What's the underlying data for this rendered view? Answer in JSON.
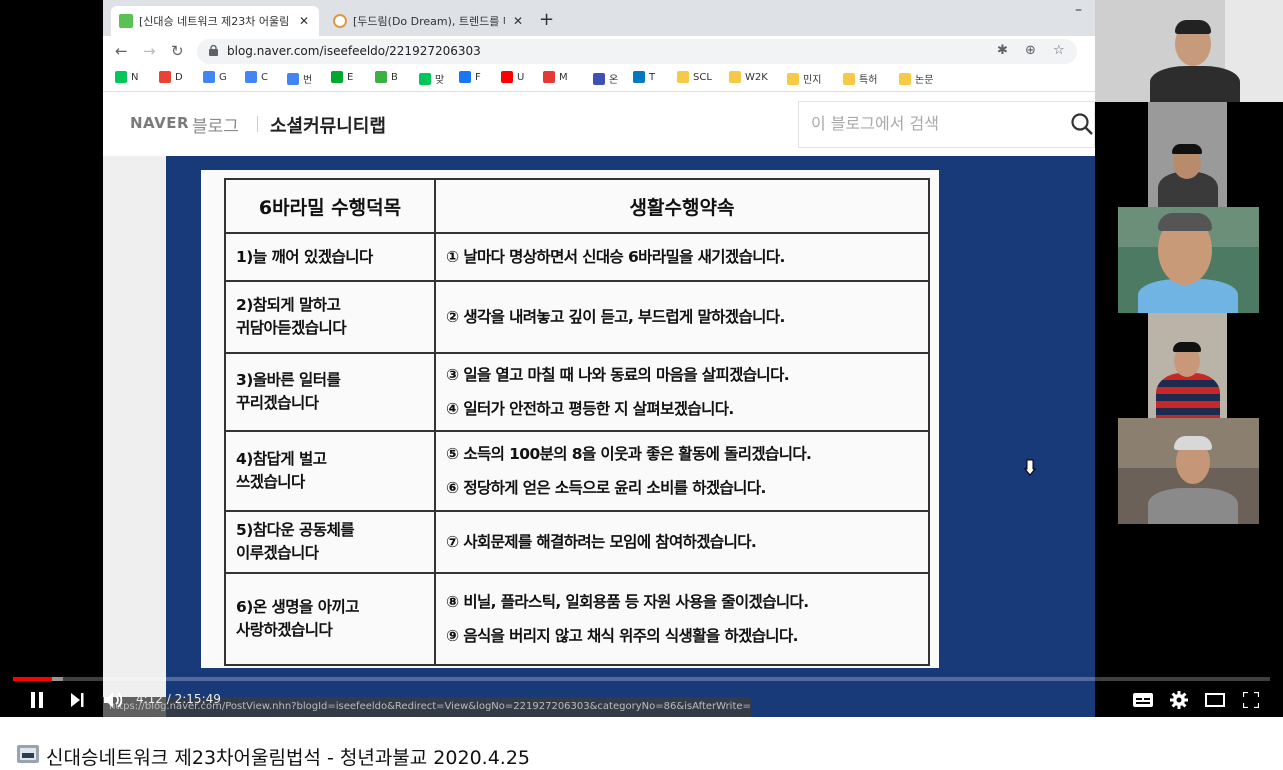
{
  "browser": {
    "tabs": [
      {
        "title": "[신대승 네트워크 제23차 어울림",
        "active": true
      },
      {
        "title": "[두드림(Do Dream), 트렌드를 다",
        "active": false
      }
    ],
    "new_tab": "+",
    "minimize": "–",
    "url": "blog.naver.com/iseefeeldo/221927206303",
    "bookmarks": [
      {
        "label": "N",
        "icon": "naver-icon",
        "color": "#03c75a"
      },
      {
        "label": "D",
        "icon": "mail-icon",
        "color": "#ea4335"
      },
      {
        "label": "G",
        "icon": "google-icon",
        "color": "#4285f4"
      },
      {
        "label": "C",
        "icon": "calendar-icon",
        "color": "#4285f4"
      },
      {
        "label": "번",
        "icon": "translate-icon",
        "color": "#4285f4"
      },
      {
        "label": "E",
        "icon": "evernote-icon",
        "color": "#00a82d"
      },
      {
        "label": "B",
        "icon": "blog-icon",
        "color": "#3bb143"
      },
      {
        "label": "맞",
        "icon": "naver-icon",
        "color": "#03c75a"
      },
      {
        "label": "F",
        "icon": "facebook-icon",
        "color": "#1877f2"
      },
      {
        "label": "U",
        "icon": "youtube-icon",
        "color": "#ff0000"
      },
      {
        "label": "M",
        "icon": "music-icon",
        "color": "#e53935"
      },
      {
        "label": "온",
        "icon": "target-icon",
        "color": "#3f51b5"
      },
      {
        "label": "T",
        "icon": "trello-icon",
        "color": "#0079bf"
      },
      {
        "label": "SCL",
        "icon": "folder-icon",
        "color": "#f7c948"
      },
      {
        "label": "W2K",
        "icon": "folder-icon",
        "color": "#f7c948"
      },
      {
        "label": "민지",
        "icon": "folder-icon",
        "color": "#f7c948"
      },
      {
        "label": "특허",
        "icon": "folder-icon",
        "color": "#f7c948"
      },
      {
        "label": "논문",
        "icon": "folder-icon",
        "color": "#f7c948"
      }
    ]
  },
  "naver": {
    "logo": "NAVER",
    "blog_word": "블로그",
    "blog_name": "소셜커뮤니티랩",
    "search_placeholder": "이 블로그에서 검색"
  },
  "slide": {
    "header_virtue": "6바라밀 수행덕목",
    "header_promise": "생활수행약속",
    "rows": [
      {
        "virtue": [
          "1)늘 깨어 있겠습니다"
        ],
        "promises": [
          "① 날마다 명상하면서 신대승 6바라밀을 새기겠습니다."
        ]
      },
      {
        "virtue": [
          "2)참되게 말하고",
          "귀담아듣겠습니다"
        ],
        "promises": [
          "② 생각을 내려놓고 깊이 듣고, 부드럽게 말하겠습니다."
        ]
      },
      {
        "virtue": [
          "3)올바른 일터를",
          "꾸리겠습니다"
        ],
        "promises": [
          "③ 일을 열고 마칠 때 나와 동료의 마음을 살피겠습니다.",
          "④ 일터가 안전하고 평등한 지 살펴보겠습니다."
        ]
      },
      {
        "virtue": [
          "4)참답게 벌고",
          "쓰겠습니다"
        ],
        "promises": [
          "⑤ 소득의 100분의 8을 이웃과 좋은 활동에 돌리겠습니다.",
          "⑥ 정당하게 얻은 소득으로 윤리 소비를 하겠습니다."
        ]
      },
      {
        "virtue": [
          "5)참다운 공동체를",
          "이루겠습니다"
        ],
        "promises": [
          "⑦ 사회문제를 해결하려는 모임에 참여하겠습니다."
        ]
      },
      {
        "virtue": [
          "6)온 생명을 아끼고",
          "사랑하겠습니다"
        ],
        "promises": [
          "⑧ 비닐, 플라스틱, 일회용품 등 자원 사용을 줄이겠습니다.",
          "⑨ 음식을 버리지 않고 채식 위주의 식생활을 하겠습니다."
        ]
      }
    ]
  },
  "player": {
    "time_current": "4:12",
    "time_total": "2:15:49",
    "time_display": "4:12 / 2:15:49",
    "played_fraction": 0.031,
    "buffered_fraction": 0.04,
    "link_hint": "https://blog.naver.com/PostView.nhn?blogId=iseefeeldo&Redirect=View&logNo=221927206303&categoryNo=86&isAfterWrite=true#",
    "accent": "#ff0000"
  },
  "video_title": "신대승네트워크 제23차어울림법석 - 청년과불교 2020.4.25"
}
